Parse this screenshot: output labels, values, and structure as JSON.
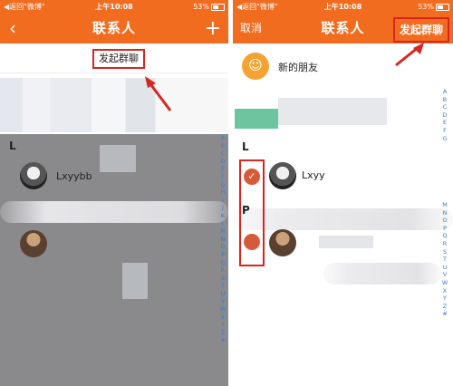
{
  "left": {
    "status": {
      "carrier": "◀返回\"微博\"",
      "time": "上午10:08",
      "battery": "53%"
    },
    "nav": {
      "back_icon": "‹",
      "title": "联系人",
      "add_icon": "+"
    },
    "group_chat_label": "发起群聊",
    "section_l": "L",
    "contact_1_name": "Lxyybb",
    "index_letters": [
      "A",
      "B",
      "C",
      "D",
      "E",
      "F",
      "G",
      "H",
      "I",
      "J",
      "K",
      "L",
      "M",
      "N",
      "O",
      "P",
      "Q",
      "R",
      "S",
      "T",
      "U",
      "V",
      "W",
      "X",
      "Y",
      "Z",
      "#"
    ]
  },
  "right": {
    "status": {
      "carrier": "◀返回\"微博\"",
      "time": "上午10:08",
      "battery": "53%"
    },
    "nav": {
      "cancel_label": "取消",
      "title": "联系人",
      "start_group_label": "发起群聊"
    },
    "new_friend_label": "新的朋友",
    "section_l": "L",
    "section_p": "P",
    "contact_1_name": "Lxyy",
    "check_icon": "✓",
    "index_letters_top": [
      "A",
      "B",
      "C",
      "D",
      "E",
      "F",
      "G"
    ],
    "index_letters_bottom": [
      "M",
      "N",
      "O",
      "P",
      "Q",
      "R",
      "S",
      "T",
      "U",
      "V",
      "W",
      "X",
      "Y",
      "Z",
      "#"
    ]
  },
  "colors": {
    "brand": "#f26c1f",
    "highlight": "#d8261f",
    "index": "#2d7fd8"
  }
}
